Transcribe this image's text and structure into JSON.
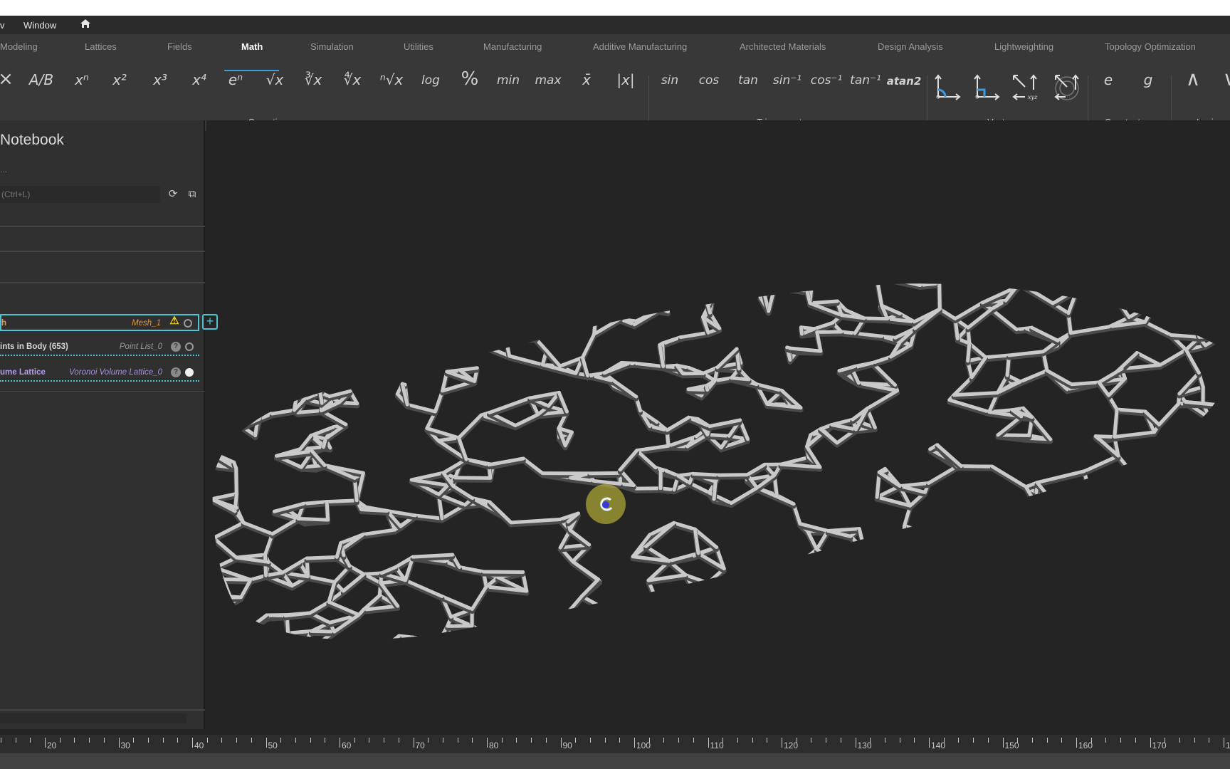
{
  "menu": {
    "items": [
      "v",
      "Window"
    ],
    "home_icon": "home-icon"
  },
  "tabs": [
    {
      "label": "Modeling",
      "active": false
    },
    {
      "label": "Lattices",
      "active": false
    },
    {
      "label": "Fields",
      "active": false
    },
    {
      "label": "Math",
      "active": true
    },
    {
      "label": "Simulation",
      "active": false
    },
    {
      "label": "Utilities",
      "active": false
    },
    {
      "label": "Manufacturing",
      "active": false
    },
    {
      "label": "Additive Manufacturing",
      "active": false
    },
    {
      "label": "Architected Materials",
      "active": false
    },
    {
      "label": "Design Analysis",
      "active": false
    },
    {
      "label": "Lightweighting",
      "active": false
    },
    {
      "label": "Topology Optimization",
      "active": false
    }
  ],
  "tools": {
    "operations": [
      "×",
      "A/B",
      "xⁿ",
      "x²",
      "x³",
      "x⁴",
      "eⁿ",
      "√x",
      "∛x",
      "∜x",
      "ⁿ√x",
      "log",
      "%",
      "min",
      "max",
      "x̄",
      "|x|"
    ],
    "trigonometry": [
      "sin",
      "cos",
      "tan",
      "sin⁻¹",
      "cos⁻¹",
      "tan⁻¹",
      "atan2"
    ],
    "vectors": [
      "vector-angle-icon",
      "vector-perpendicular-icon",
      "vector-components-icon",
      "vector-polar-icon"
    ],
    "constants": [
      "e",
      "g"
    ],
    "logic": [
      "∧",
      "∨"
    ]
  },
  "groups": {
    "operations": "Operations",
    "trigonometry": "Trigonometry",
    "vectors": "Vectors",
    "constants": "Constants",
    "logic": "Logic"
  },
  "panel": {
    "title": "Notebook",
    "subtitle": "...",
    "search_placeholder": "(Ctrl+L)",
    "rows": [
      {
        "name": "h",
        "ref": "Mesh_1",
        "status": "warning",
        "visible": false
      },
      {
        "name": "ints in Body (653)",
        "ref": "Point List_0",
        "status": "info",
        "visible": false
      },
      {
        "name": "ume Lattice",
        "ref": "Voronoi Volume Lattice_0",
        "status": "info",
        "visible": true
      }
    ]
  },
  "ruler": {
    "unit_step": 10,
    "labels": [
      "20",
      "30",
      "40",
      "50",
      "60",
      "70",
      "80",
      "90",
      "100",
      "110",
      "120",
      "130",
      "140",
      "150",
      "160",
      "170",
      "1"
    ]
  },
  "viewport": {
    "object": "Voronoi Volume Lattice",
    "color": "#c9c9c9",
    "pivot_color": "#d8d23a"
  },
  "colors": {
    "accent": "#3d9be0",
    "selection": "#4fc3d6",
    "warning": "#f2d21b",
    "mesh": "#e89a3c",
    "lattice": "#b79ae8"
  }
}
